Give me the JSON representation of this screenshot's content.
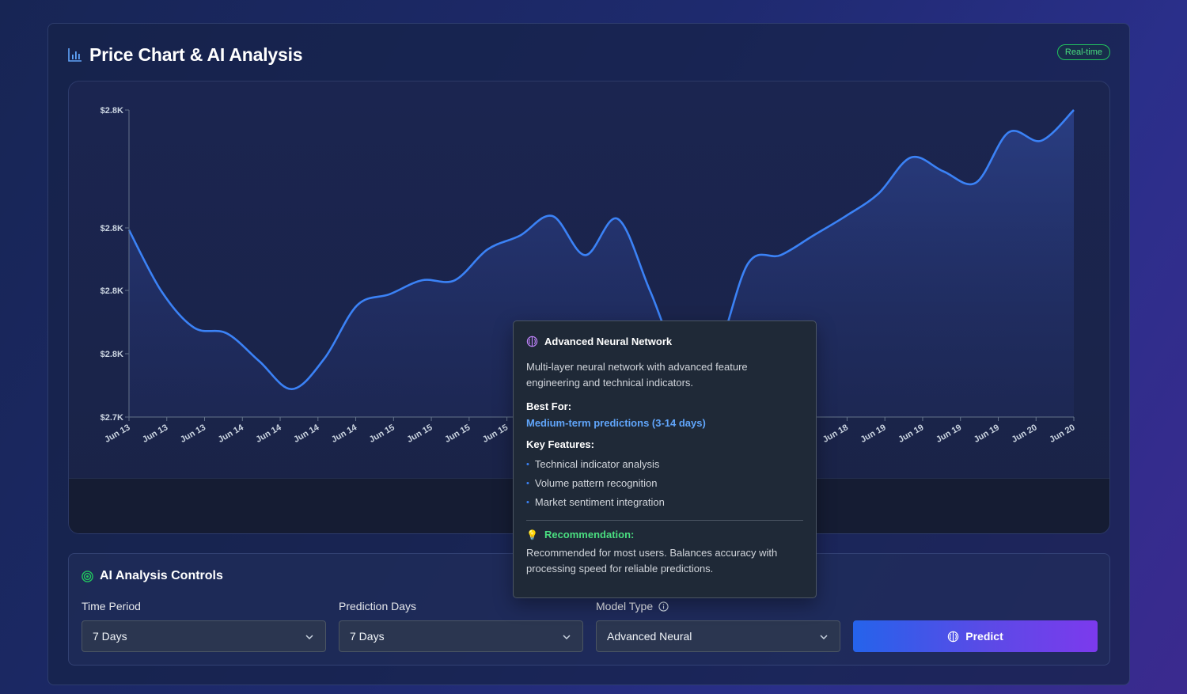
{
  "header": {
    "title": "Price Chart & AI Analysis",
    "badge": "Real-time",
    "title_icon": "bar-chart-icon"
  },
  "chart_data": {
    "type": "area",
    "y_tick_labels": [
      "$2.8K",
      "$2.8K",
      "$2.8K",
      "$2.8K",
      "$2.7K"
    ],
    "x_tick_labels": [
      "Jun 13",
      "Jun 13",
      "Jun 13",
      "Jun 14",
      "Jun 14",
      "Jun 14",
      "Jun 14",
      "Jun 15",
      "Jun 15",
      "Jun 15",
      "Jun 15",
      "Jun 16",
      "Jun 16",
      "Jun 16",
      "Jun 17",
      "Jun 17",
      "Jun 17",
      "Jun 17",
      "Jun 18",
      "Jun 18",
      "Jun 19",
      "Jun 19",
      "Jun 19",
      "Jun 19",
      "Jun 20",
      "Jun 20"
    ],
    "values": [
      2787,
      2765,
      2752,
      2750,
      2740,
      2730,
      2741,
      2760,
      2764,
      2769,
      2769,
      2780,
      2785,
      2792,
      2778,
      2791,
      2765,
      2738,
      2742,
      2775,
      2778,
      2785,
      2792,
      2800,
      2813,
      2808,
      2804,
      2822,
      2819,
      2830
    ],
    "ylim": [
      2720,
      2830
    ],
    "line_color": "#3b82f6",
    "grid": false
  },
  "controls": {
    "title": "AI Analysis Controls",
    "time_period": {
      "label": "Time Period",
      "value": "7 Days"
    },
    "prediction_days": {
      "label": "Prediction Days",
      "value": "7 Days"
    },
    "model_type": {
      "label": "Model Type",
      "value": "Advanced Neural"
    },
    "predict_label": "Predict"
  },
  "tooltip": {
    "title": "Advanced Neural Network",
    "description": "Multi-layer neural network with advanced feature engineering and technical indicators.",
    "best_for_label": "Best For:",
    "best_for": "Medium-term predictions (3-14 days)",
    "key_features_label": "Key Features:",
    "features": [
      "Technical indicator analysis",
      "Volume pattern recognition",
      "Market sentiment integration"
    ],
    "recommendation_label": "Recommendation:",
    "recommendation": "Recommended for most users. Balances accuracy with processing speed for reliable predictions."
  },
  "colors": {
    "accent_blue": "#3b82f6",
    "accent_purple": "#7c3aed",
    "success_green": "#4ade80"
  }
}
